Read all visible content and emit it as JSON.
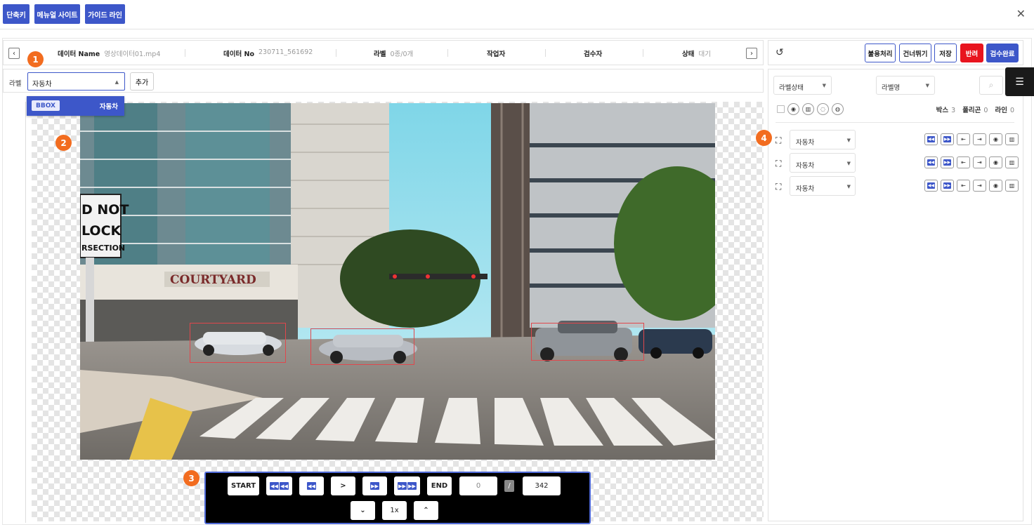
{
  "toolbar": {
    "shortcut": "단축키",
    "manual_site": "메뉴얼 사이트",
    "guide_line": "가이드 라인"
  },
  "info": {
    "data_name_label": "데이터 Name",
    "data_name_value": "영상데이터01.mp4",
    "data_no_label": "데이터 No",
    "data_no_value": "230711_561692",
    "label_label": "라벨",
    "label_value": "0종/0개",
    "worker_label": "작업자",
    "reviewer_label": "검수자",
    "status_label": "상태",
    "status_value": "대기"
  },
  "label_row": {
    "title": "라벨",
    "selected": "자동차",
    "add": "추가"
  },
  "dropdown": {
    "tag": "BBOX",
    "text": "자동차"
  },
  "badges": [
    "1",
    "2",
    "3",
    "4"
  ],
  "player": {
    "start": "START",
    "end": "END",
    "play": ">",
    "current_frame": "0",
    "slash": "/",
    "total_frames": "342",
    "speed": "1x",
    "down": "⌄",
    "up": "⌃"
  },
  "right_top": {
    "reject": "불용처리",
    "skip": "건너뛰기",
    "save": "저장",
    "return": "반려",
    "complete": "검수완료"
  },
  "filters": {
    "status": "라벨상태",
    "name": "라벨명"
  },
  "counts": {
    "box_label": "박스",
    "box_value": "3",
    "polygon_label": "폴리곤",
    "polygon_value": "0",
    "line_label": "라인",
    "line_value": "0"
  },
  "items": [
    {
      "label": "자동차"
    },
    {
      "label": "자동차"
    },
    {
      "label": "자동차"
    }
  ],
  "colors": {
    "accent": "#3d57c9",
    "danger": "#e8141e",
    "badge": "#f26c1f",
    "bbox": "#e0474c"
  }
}
